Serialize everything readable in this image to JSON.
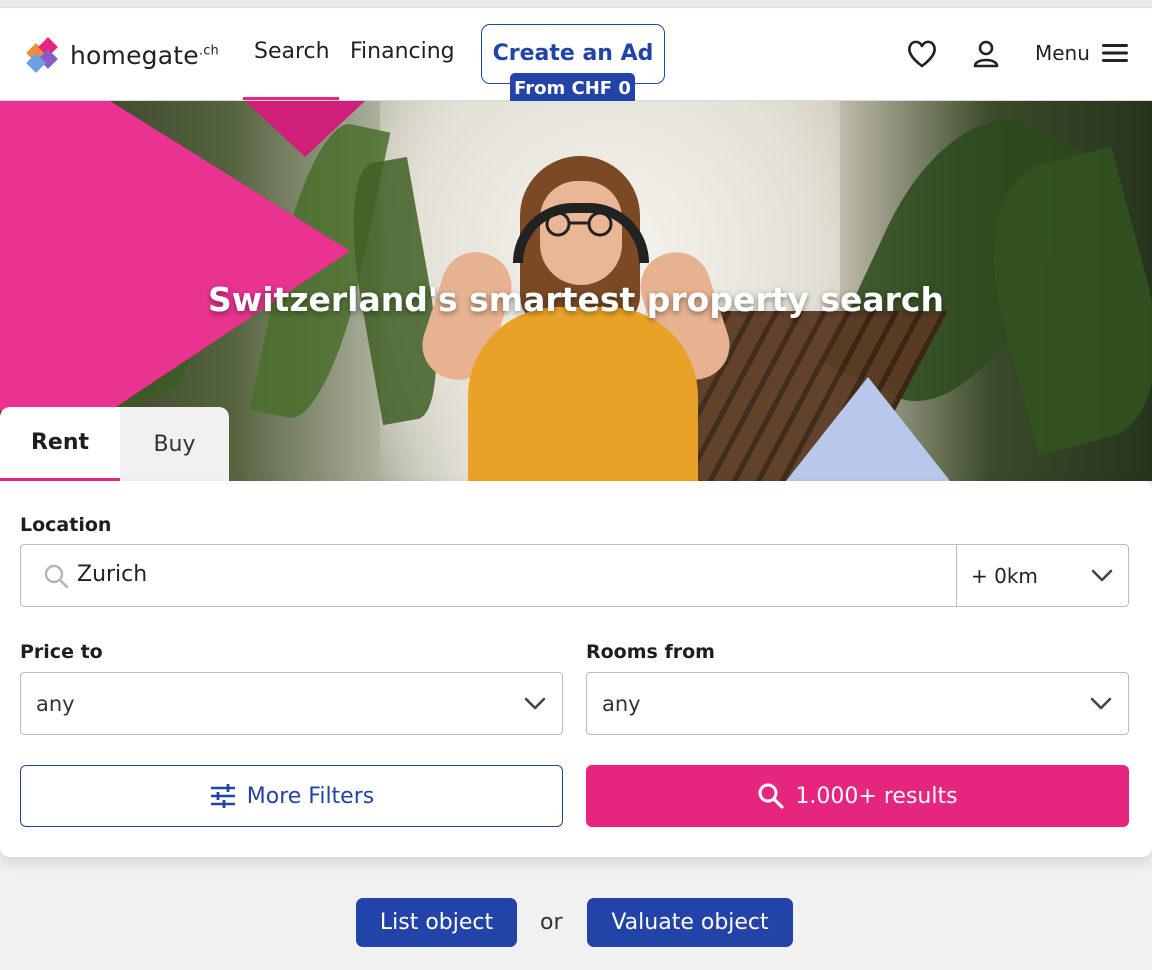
{
  "header": {
    "logo_text": "homegate",
    "logo_suffix": ".ch",
    "nav": [
      {
        "label": "Search",
        "active": true
      },
      {
        "label": "Financing",
        "active": false
      }
    ],
    "create_ad_label": "Create an Ad",
    "create_ad_badge": "From CHF 0",
    "menu_label": "Menu",
    "icons": [
      "heart-icon",
      "user-icon",
      "hamburger-icon"
    ]
  },
  "hero": {
    "title": "Switzerland's smartest property search"
  },
  "tabs": [
    {
      "label": "Rent",
      "active": true
    },
    {
      "label": "Buy",
      "active": false
    }
  ],
  "search": {
    "location_label": "Location",
    "location_value": "Zurich",
    "radius_value": "+ 0km",
    "price_label": "Price to",
    "price_value": "any",
    "rooms_label": "Rooms from",
    "rooms_value": "any",
    "more_filters_label": "More Filters",
    "results_label": "1.000+ results"
  },
  "footer_actions": {
    "list_label": "List object",
    "or_text": "or",
    "valuate_label": "Valuate object"
  },
  "colors": {
    "brand_blue": "#2244a8",
    "brand_pink": "#e6267e",
    "accent_light_blue": "#b7c8ea"
  }
}
